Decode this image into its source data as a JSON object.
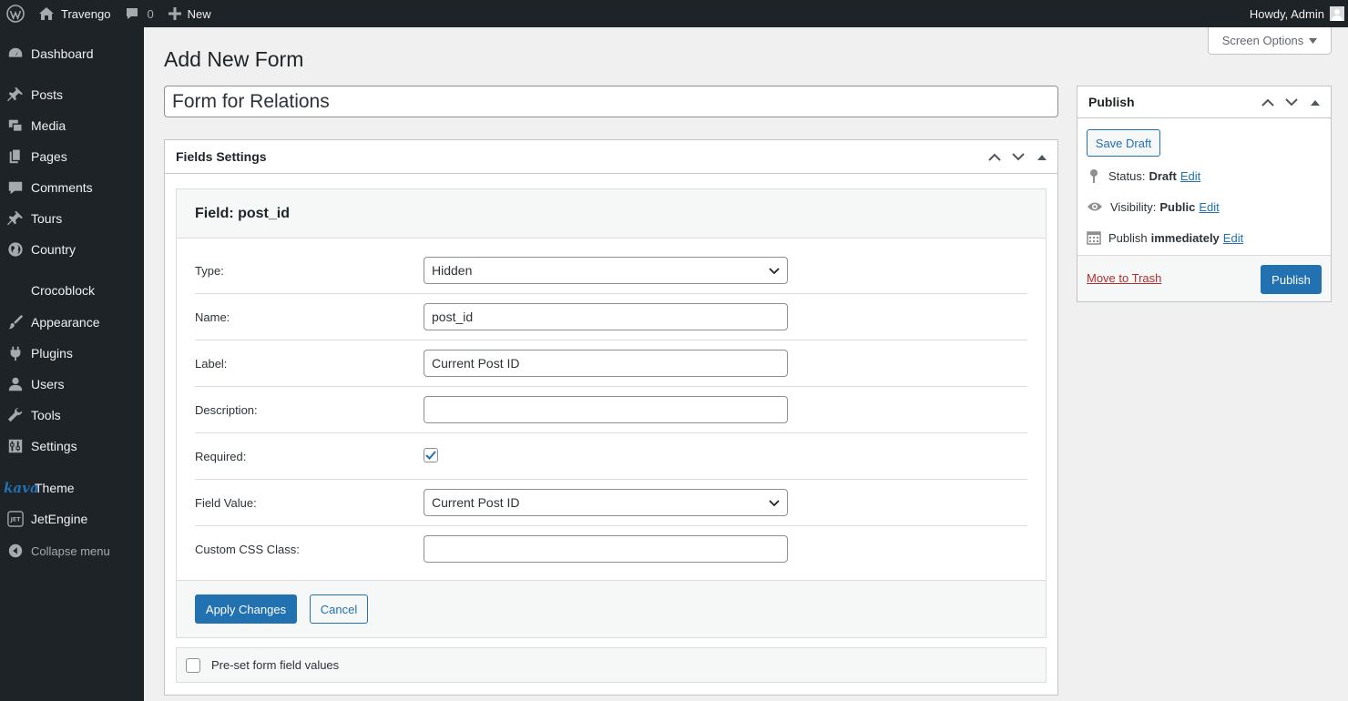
{
  "adminbar": {
    "site_name": "Travengo",
    "comments_count": "0",
    "new_label": "New",
    "howdy": "Howdy, Admin"
  },
  "sidebar": {
    "items": [
      {
        "label": "Dashboard",
        "icon": "dashboard-icon"
      },
      {
        "label": "Posts",
        "icon": "pin-icon"
      },
      {
        "label": "Media",
        "icon": "media-icon"
      },
      {
        "label": "Pages",
        "icon": "pages-icon"
      },
      {
        "label": "Comments",
        "icon": "comment-icon"
      },
      {
        "label": "Tours",
        "icon": "pin-icon"
      },
      {
        "label": "Country",
        "icon": "globe-icon"
      },
      {
        "label": "Crocoblock",
        "icon": "crocoblock-icon"
      },
      {
        "label": "Appearance",
        "icon": "brush-icon"
      },
      {
        "label": "Plugins",
        "icon": "plugin-icon"
      },
      {
        "label": "Users",
        "icon": "user-icon"
      },
      {
        "label": "Tools",
        "icon": "wrench-icon"
      },
      {
        "label": "Settings",
        "icon": "settings-icon"
      },
      {
        "label": "Theme",
        "icon": "kava-logo",
        "prefix": "kava"
      },
      {
        "label": "JetEngine",
        "icon": "jetengine-icon"
      },
      {
        "label": "Collapse menu",
        "icon": "collapse-icon"
      }
    ]
  },
  "header": {
    "screen_options": "Screen Options",
    "title": "Add New Form",
    "post_title": "Form for Relations"
  },
  "fields_settings": {
    "title": "Fields Settings",
    "field_heading": "Field: post_id",
    "rows": {
      "type": {
        "label": "Type:",
        "value": "Hidden"
      },
      "name": {
        "label": "Name:",
        "value": "post_id"
      },
      "label": {
        "label": "Label:",
        "value": "Current Post ID"
      },
      "description": {
        "label": "Description:",
        "value": ""
      },
      "required": {
        "label": "Required:",
        "checked": true
      },
      "field_value": {
        "label": "Field Value:",
        "value": "Current Post ID"
      },
      "css_class": {
        "label": "Custom CSS Class:",
        "value": ""
      }
    },
    "apply_label": "Apply Changes",
    "cancel_label": "Cancel",
    "preset_label": "Pre-set form field values"
  },
  "publish": {
    "title": "Publish",
    "save_draft": "Save Draft",
    "status_label": "Status:",
    "status_value": "Draft",
    "visibility_label": "Visibility:",
    "visibility_value": "Public",
    "publish_label": "Publish",
    "publish_value": "immediately",
    "edit": "Edit",
    "trash": "Move to Trash",
    "publish_button": "Publish"
  },
  "colors": {
    "admin_bar": "#1d2327",
    "accent": "#2271b1",
    "trash": "#b32d2e"
  }
}
